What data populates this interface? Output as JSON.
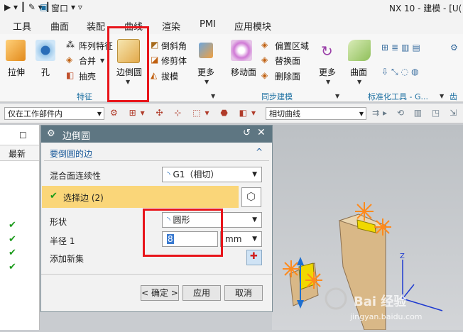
{
  "titlebar": {
    "window_menu": "窗口",
    "title": "NX 10 - 建模 - [U("
  },
  "tabs": [
    "工具",
    "曲面",
    "装配",
    "曲线",
    "渲染",
    "PMI",
    "应用模块"
  ],
  "ribbon": {
    "extrude": "拉伸",
    "hole": "孔",
    "pattern_feature": "阵列特征",
    "unite": "合并",
    "shell": "抽壳",
    "edge_blend": "边倒圆",
    "chamfer": "倒斜角",
    "trim_body": "修剪体",
    "draft": "拔模",
    "more1": "更多",
    "move_face": "移动面",
    "offset_region": "偏置区域",
    "replace_face": "替换面",
    "delete_face": "删除面",
    "more2": "更多",
    "surface": "曲面",
    "group_feature": "特征",
    "group_sync": "同步建模",
    "group_std": "标准化工具 - G...",
    "group_gear": "齿轮"
  },
  "toolbar": {
    "filter": "仅在工作部件内",
    "curve_rule": "相切曲线"
  },
  "leftpanel": {
    "header": "最新"
  },
  "dialog": {
    "title": "边倒圆",
    "section": "要倒圆的边",
    "continuity_label": "混合面连续性",
    "continuity_value": "G1（相切）",
    "select_edge": "选择边 (2)",
    "shape_label": "形状",
    "shape_value": "圆形",
    "radius_label": "半径 1",
    "radius_value": "8",
    "radius_unit": "mm",
    "add_set_label": "添加新集",
    "ok": "< 确定 >",
    "apply": "应用",
    "cancel": "取消"
  },
  "watermark": {
    "brand": "Bai 经验",
    "url": "jingyan.baidu.com"
  },
  "colors": {
    "dialog_title": "#5e7682",
    "selected_row": "#fad679",
    "annotation": "#e8151b",
    "check": "#1a9a1a"
  }
}
